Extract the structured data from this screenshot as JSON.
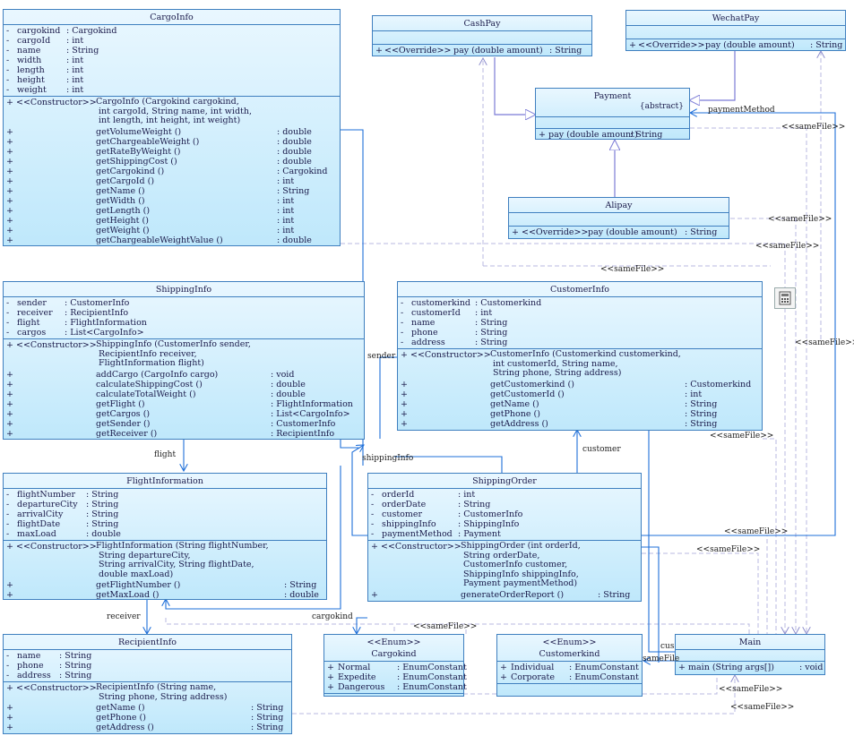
{
  "classes": {
    "cargoinfo": {
      "name": "CargoInfo",
      "attributes": [
        {
          "v": "-",
          "n": "cargokind",
          "t": ": Cargokind"
        },
        {
          "v": "-",
          "n": "cargoId",
          "t": ": int"
        },
        {
          "v": "-",
          "n": "name",
          "t": ": String"
        },
        {
          "v": "-",
          "n": "width",
          "t": ": int"
        },
        {
          "v": "-",
          "n": "length",
          "t": ": int"
        },
        {
          "v": "-",
          "n": "height",
          "t": ": int"
        },
        {
          "v": "-",
          "n": "weight",
          "t": ": int"
        }
      ],
      "ctor": {
        "v": "+",
        "s": "<<Constructor>>",
        "text": "CargoInfo (Cargokind cargokind,\n int cargoId, String name, int width,\n int length, int height, int weight)"
      },
      "methods": [
        {
          "v": "+",
          "n": "getVolumeWeight ()",
          "t": ": double"
        },
        {
          "v": "+",
          "n": "getChargeableWeight ()",
          "t": ": double"
        },
        {
          "v": "+",
          "n": "getRateByWeight ()",
          "t": ": double"
        },
        {
          "v": "+",
          "n": "getShippingCost ()",
          "t": ": double"
        },
        {
          "v": "+",
          "n": "getCargokind ()",
          "t": ": Cargokind"
        },
        {
          "v": "+",
          "n": "getCargoId ()",
          "t": ": int"
        },
        {
          "v": "+",
          "n": "getName ()",
          "t": ": String"
        },
        {
          "v": "+",
          "n": "getWidth ()",
          "t": ": int"
        },
        {
          "v": "+",
          "n": "getLength ()",
          "t": ": int"
        },
        {
          "v": "+",
          "n": "getHeight ()",
          "t": ": int"
        },
        {
          "v": "+",
          "n": "getWeight ()",
          "t": ": int"
        },
        {
          "v": "+",
          "n": "getChargeableWeightValue ()",
          "t": ": double"
        }
      ]
    },
    "cashpay": {
      "name": "CashPay",
      "methods": [
        {
          "v": "+",
          "s": "<<Override>>",
          "n": "pay (double amount)",
          "t": ": String"
        }
      ]
    },
    "wechatpay": {
      "name": "WechatPay",
      "methods": [
        {
          "v": "+",
          "s": "<<Override>>",
          "n": "pay (double amount)",
          "t": ": String"
        }
      ]
    },
    "payment": {
      "name": "Payment",
      "abstract": "{abstract}",
      "methods": [
        {
          "v": "+",
          "n": "pay (double amount)",
          "t": ": String"
        }
      ]
    },
    "alipay": {
      "name": "Alipay",
      "methods": [
        {
          "v": "+",
          "s": "<<Override>>",
          "n": "pay (double amount)",
          "t": ": String"
        }
      ]
    },
    "shippinginfo": {
      "name": "ShippingInfo",
      "attributes": [
        {
          "v": "-",
          "n": "sender",
          "t": ": CustomerInfo"
        },
        {
          "v": "-",
          "n": "receiver",
          "t": ": RecipientInfo"
        },
        {
          "v": "-",
          "n": "flight",
          "t": ": FlightInformation"
        },
        {
          "v": "-",
          "n": "cargos",
          "t": ": List<CargoInfo>"
        }
      ],
      "ctor": {
        "v": "+",
        "s": "<<Constructor>>",
        "text": "ShippingInfo (CustomerInfo sender,\n RecipientInfo receiver,\n FlightInformation flight)"
      },
      "methods": [
        {
          "v": "+",
          "n": "addCargo (CargoInfo cargo)",
          "t": ": void"
        },
        {
          "v": "+",
          "n": "calculateShippingCost ()",
          "t": ": double"
        },
        {
          "v": "+",
          "n": "calculateTotalWeight ()",
          "t": ": double"
        },
        {
          "v": "+",
          "n": "getFlight ()",
          "t": ": FlightInformation"
        },
        {
          "v": "+",
          "n": "getCargos ()",
          "t": ": List<CargoInfo>"
        },
        {
          "v": "+",
          "n": "getSender ()",
          "t": ": CustomerInfo"
        },
        {
          "v": "+",
          "n": "getReceiver ()",
          "t": ": RecipientInfo"
        }
      ]
    },
    "customerinfo": {
      "name": "CustomerInfo",
      "attributes": [
        {
          "v": "-",
          "n": "customerkind",
          "t": ": Customerkind"
        },
        {
          "v": "-",
          "n": "customerId",
          "t": ": int"
        },
        {
          "v": "-",
          "n": "name",
          "t": ": String"
        },
        {
          "v": "-",
          "n": "phone",
          "t": ": String"
        },
        {
          "v": "-",
          "n": "address",
          "t": ": String"
        }
      ],
      "ctor": {
        "v": "+",
        "s": "<<Constructor>>",
        "text": "CustomerInfo (Customerkind customerkind,\n int customerId, String name,\n String phone, String address)"
      },
      "methods": [
        {
          "v": "+",
          "n": "getCustomerkind ()",
          "t": ": Customerkind"
        },
        {
          "v": "+",
          "n": "getCustomerId ()",
          "t": ": int"
        },
        {
          "v": "+",
          "n": "getName ()",
          "t": ": String"
        },
        {
          "v": "+",
          "n": "getPhone ()",
          "t": ": String"
        },
        {
          "v": "+",
          "n": "getAddress ()",
          "t": ": String"
        }
      ]
    },
    "flightinformation": {
      "name": "FlightInformation",
      "attributes": [
        {
          "v": "-",
          "n": "flightNumber",
          "t": ": String"
        },
        {
          "v": "-",
          "n": "departureCity",
          "t": ": String"
        },
        {
          "v": "-",
          "n": "arrivalCity",
          "t": ": String"
        },
        {
          "v": "-",
          "n": "flightDate",
          "t": ": String"
        },
        {
          "v": "-",
          "n": "maxLoad",
          "t": ": double"
        }
      ],
      "ctor": {
        "v": "+",
        "s": "<<Constructor>>",
        "text": "FlightInformation (String flightNumber,\n String departureCity,\n String arrivalCity, String flightDate,\n double maxLoad)"
      },
      "methods": [
        {
          "v": "+",
          "n": "getFlightNumber ()",
          "t": ": String"
        },
        {
          "v": "+",
          "n": "getMaxLoad ()",
          "t": ": double"
        }
      ]
    },
    "shippingorder": {
      "name": "ShippingOrder",
      "attributes": [
        {
          "v": "-",
          "n": "orderId",
          "t": ": int"
        },
        {
          "v": "-",
          "n": "orderDate",
          "t": ": String"
        },
        {
          "v": "-",
          "n": "customer",
          "t": ": CustomerInfo"
        },
        {
          "v": "-",
          "n": "shippingInfo",
          "t": ": ShippingInfo"
        },
        {
          "v": "-",
          "n": "paymentMethod",
          "t": ": Payment"
        }
      ],
      "ctor": {
        "v": "+",
        "s": "<<Constructor>>",
        "text": "ShippingOrder (int orderId,\n String orderDate,\n CustomerInfo customer,\n ShippingInfo shippingInfo,\n Payment paymentMethod)"
      },
      "methods": [
        {
          "v": "+",
          "n": "generateOrderReport ()",
          "t": ": String"
        }
      ]
    },
    "recipientinfo": {
      "name": "RecipientInfo",
      "attributes": [
        {
          "v": "-",
          "n": "name",
          "t": ": String"
        },
        {
          "v": "-",
          "n": "phone",
          "t": ": String"
        },
        {
          "v": "-",
          "n": "address",
          "t": ": String"
        }
      ],
      "ctor": {
        "v": "+",
        "s": "<<Constructor>>",
        "text": "RecipientInfo (String name,\n String phone, String address)"
      },
      "methods": [
        {
          "v": "+",
          "n": "getName ()",
          "t": ": String"
        },
        {
          "v": "+",
          "n": "getPhone ()",
          "t": ": String"
        },
        {
          "v": "+",
          "n": "getAddress ()",
          "t": ": String"
        }
      ]
    },
    "cargokind": {
      "name": "Cargokind",
      "stereotype": "<<Enum>>",
      "attributes": [
        {
          "v": "+",
          "n": "Normal",
          "t": ": EnumConstant"
        },
        {
          "v": "+",
          "n": "Expedite",
          "t": ": EnumConstant"
        },
        {
          "v": "+",
          "n": "Dangerous",
          "t": ": EnumConstant"
        }
      ]
    },
    "customerkind": {
      "name": "Customerkind",
      "stereotype": "<<Enum>>",
      "attributes": [
        {
          "v": "+",
          "n": "Individual",
          "t": ": EnumConstant"
        },
        {
          "v": "+",
          "n": "Corporate",
          "t": ": EnumConstant"
        }
      ]
    },
    "main": {
      "name": "Main",
      "methods": [
        {
          "v": "+",
          "n": "main (String args[])",
          "t": ": void"
        }
      ]
    }
  },
  "labels": {
    "samefile": "<<sameFile>>",
    "paymentMethod": "paymentMethod",
    "sender": "sender",
    "flight": "flight",
    "shippingInfo": "shippingInfo",
    "customer": "customer",
    "receiver": "receiver",
    "cargokind": "cargokind",
    "cus": "cus",
    "samefile_trunc": "sameFile"
  },
  "colors": {
    "border": "#3f7fbf",
    "fill_top": "#e9f7ff",
    "fill_bottom": "#bfe8fb",
    "assoc": "#1e6fd9",
    "generalize": "#7b7bd6",
    "dependency": "#b8b8e0"
  }
}
